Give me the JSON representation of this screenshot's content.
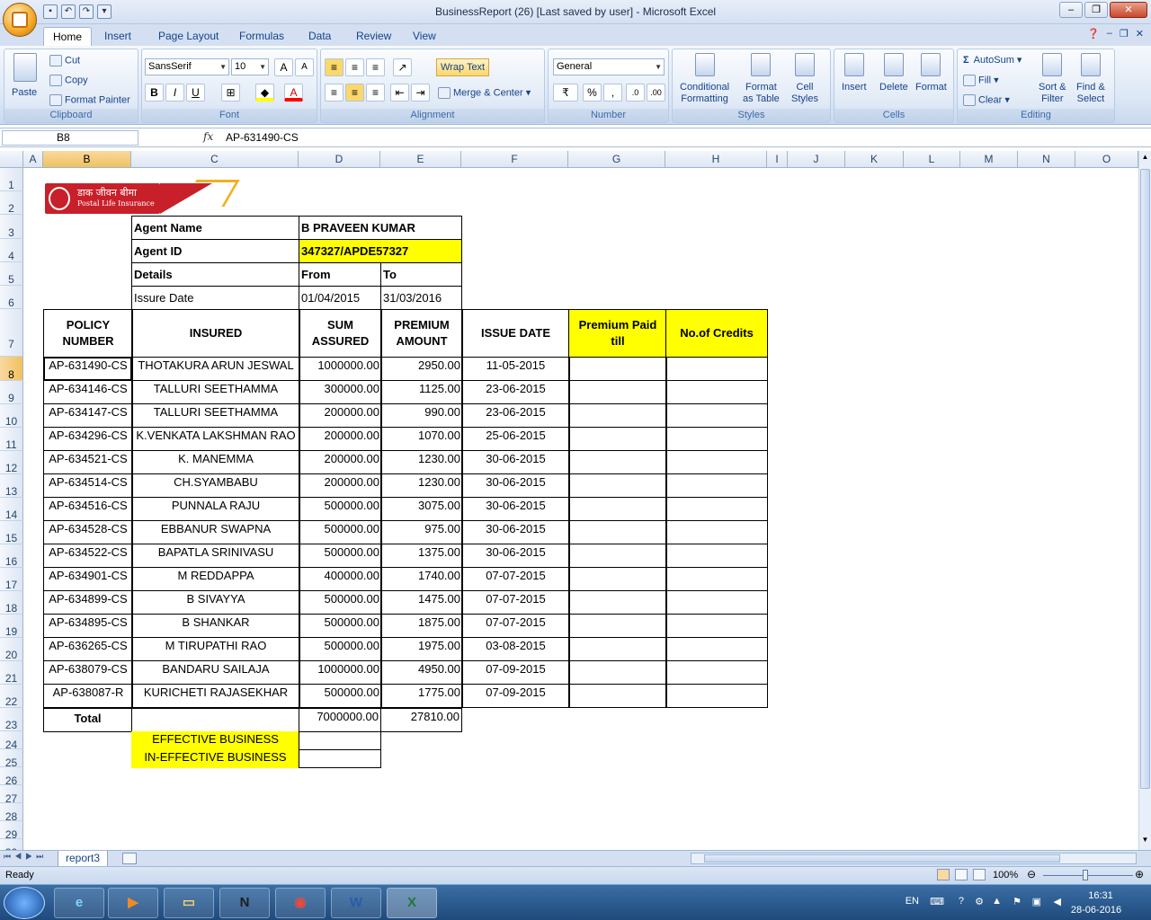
{
  "window": {
    "title": "BusinessReport (26) [Last saved by user] - Microsoft Excel"
  },
  "tabs": [
    "Home",
    "Insert",
    "Page Layout",
    "Formulas",
    "Data",
    "Review",
    "View"
  ],
  "ribbon": {
    "clipboard": {
      "paste": "Paste",
      "cut": "Cut",
      "copy": "Copy",
      "format_painter": "Format Painter",
      "label": "Clipboard"
    },
    "font": {
      "name": "SansSerif",
      "size": "10",
      "label": "Font"
    },
    "alignment": {
      "wrap_text": "Wrap Text",
      "merge_center": "Merge & Center",
      "label": "Alignment"
    },
    "number": {
      "format": "General",
      "label": "Number"
    },
    "styles": {
      "conditional_1": "Conditional",
      "conditional_2": "Formatting",
      "format_table_1": "Format",
      "format_table_2": "as Table",
      "cell_styles_1": "Cell",
      "cell_styles_2": "Styles",
      "label": "Styles"
    },
    "cells": {
      "insert": "Insert",
      "delete": "Delete",
      "format": "Format",
      "label": "Cells"
    },
    "editing": {
      "autosum": "AutoSum",
      "fill": "Fill",
      "clear": "Clear",
      "sort_1": "Sort &",
      "sort_2": "Filter",
      "find_1": "Find &",
      "find_2": "Select",
      "label": "Editing"
    }
  },
  "formula_bar": {
    "name_box": "B8",
    "fx": "fx",
    "formula": "AP-631490-CS"
  },
  "columns": [
    "A",
    "B",
    "C",
    "D",
    "E",
    "F",
    "G",
    "H",
    "I",
    "J",
    "K",
    "L",
    "M",
    "N",
    "O"
  ],
  "rows": [
    "1",
    "2",
    "3",
    "4",
    "5",
    "6",
    "7",
    "8",
    "9",
    "10",
    "11",
    "12",
    "13",
    "14",
    "15",
    "16",
    "17",
    "18",
    "19",
    "20",
    "21",
    "22",
    "23",
    "24",
    "25",
    "26",
    "27",
    "28",
    "29",
    "30"
  ],
  "logo": {
    "hindi": "डाक जीवन बीमा",
    "english": "Postal Life Insurance"
  },
  "agent": {
    "name_label": "Agent Name",
    "name": "B PRAVEEN KUMAR",
    "id_label": "Agent ID",
    "id": "347327/APDE57327",
    "details_label": "Details",
    "from_label": "From",
    "to_label": "To",
    "issue_label": "Issure Date",
    "from": "01/04/2015",
    "to": "31/03/2016"
  },
  "table": {
    "headers": [
      "POLICY NUMBER",
      "INSURED",
      "SUM ASSURED",
      "PREMIUM AMOUNT",
      "ISSUE DATE",
      "Premium Paid till",
      "No.of Credits"
    ],
    "rows": [
      [
        "AP-631490-CS",
        "THOTAKURA ARUN JESWAL",
        "1000000.00",
        "2950.00",
        "11-05-2015"
      ],
      [
        "AP-634146-CS",
        "TALLURI SEETHAMMA",
        "300000.00",
        "1125.00",
        "23-06-2015"
      ],
      [
        "AP-634147-CS",
        "TALLURI SEETHAMMA",
        "200000.00",
        "990.00",
        "23-06-2015"
      ],
      [
        "AP-634296-CS",
        "K.VENKATA LAKSHMAN RAO",
        "200000.00",
        "1070.00",
        "25-06-2015"
      ],
      [
        "AP-634521-CS",
        "K. MANEMMA",
        "200000.00",
        "1230.00",
        "30-06-2015"
      ],
      [
        "AP-634514-CS",
        "CH.SYAMBABU",
        "200000.00",
        "1230.00",
        "30-06-2015"
      ],
      [
        "AP-634516-CS",
        "PUNNALA RAJU",
        "500000.00",
        "3075.00",
        "30-06-2015"
      ],
      [
        "AP-634528-CS",
        "EBBANUR SWAPNA",
        "500000.00",
        "975.00",
        "30-06-2015"
      ],
      [
        "AP-634522-CS",
        "BAPATLA SRINIVASU",
        "500000.00",
        "1375.00",
        "30-06-2015"
      ],
      [
        "AP-634901-CS",
        "M REDDAPPA",
        "400000.00",
        "1740.00",
        "07-07-2015"
      ],
      [
        "AP-634899-CS",
        "B SIVAYYA",
        "500000.00",
        "1475.00",
        "07-07-2015"
      ],
      [
        "AP-634895-CS",
        "B SHANKAR",
        "500000.00",
        "1875.00",
        "07-07-2015"
      ],
      [
        "AP-636265-CS",
        "M TIRUPATHI RAO",
        "500000.00",
        "1975.00",
        "03-08-2015"
      ],
      [
        "AP-638079-CS",
        "BANDARU SAILAJA",
        "1000000.00",
        "4950.00",
        "07-09-2015"
      ],
      [
        "AP-638087-R",
        "KURICHETI RAJASEKHAR",
        "500000.00",
        "1775.00",
        "07-09-2015"
      ]
    ],
    "total_label": "Total",
    "total_sum": "7000000.00",
    "total_premium": "27810.00",
    "effective": "EFFECTIVE BUSINESS",
    "ineffective": "IN-EFFECTIVE BUSINESS"
  },
  "sheet": {
    "tab": "report3"
  },
  "status": {
    "ready": "Ready",
    "zoom": "100%"
  },
  "taskbar": {
    "lang": "EN",
    "time": "16:31",
    "date": "28-06-2016"
  },
  "colors": {
    "yellow": "#ffff00",
    "accent": "#15428b"
  }
}
